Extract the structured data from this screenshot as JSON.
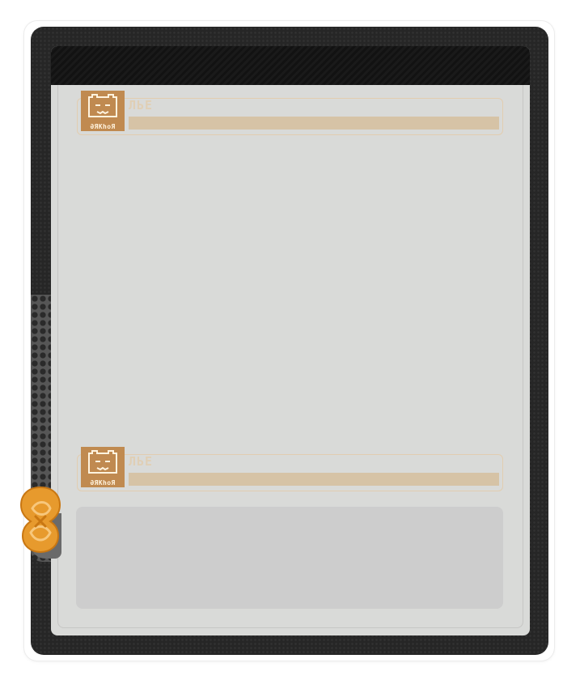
{
  "colors": {
    "frame": "#262626",
    "screen": "#d9dad8",
    "top_bar": "#121212",
    "card_border": "#e2cdb0",
    "avatar_bg": "#c08a50",
    "message_bar": "#d6c3a6",
    "input_bg": "#cdcdcd",
    "badge": "#e79a2d"
  },
  "messages": [
    {
      "avatar_caption": "ƏЯKhoЯ",
      "sender": "ЛЬЕ",
      "avatar_icon": "cat-face-icon"
    },
    {
      "avatar_caption": "ƏЯKhoЯ",
      "sender": "ЛЬЕ",
      "avatar_icon": "cat-face-icon"
    }
  ],
  "floating_badge": {
    "icon": "orange-knot-icon"
  }
}
